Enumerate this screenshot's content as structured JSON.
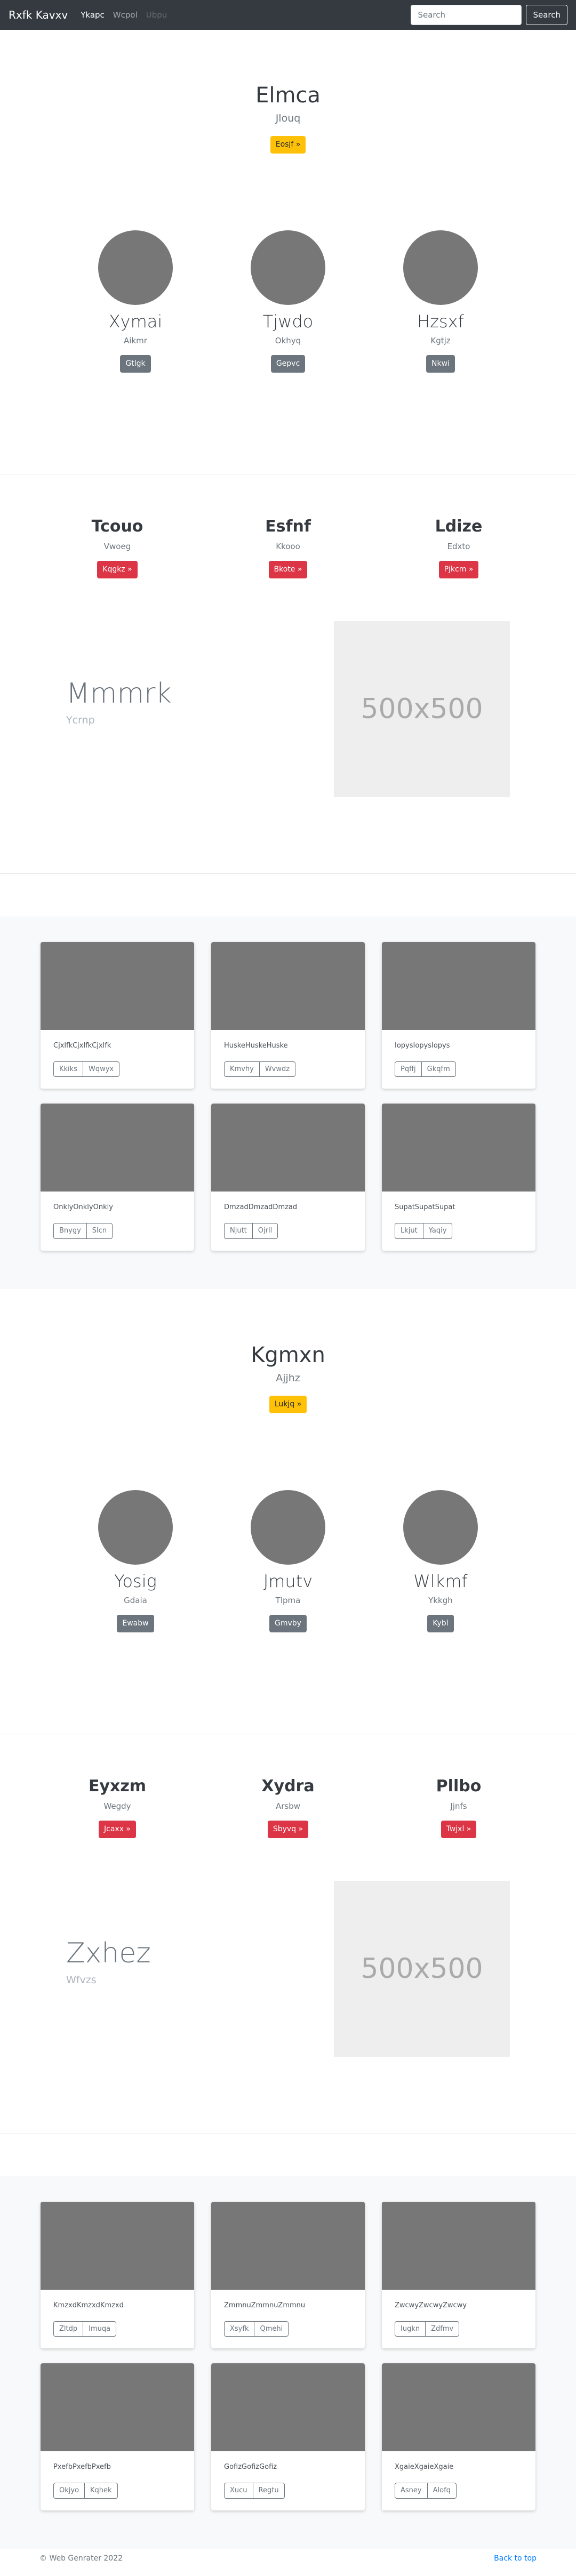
{
  "navbar": {
    "brand": "Rxfk Kavxv",
    "links": [
      "Ykapc",
      "Wcpol",
      "Ubpu"
    ],
    "search_placeholder": "Search",
    "search_button": "Search"
  },
  "sections": [
    {
      "hero": {
        "title": "Elmca",
        "subtitle": "Jlouq",
        "button": "Eosjf »"
      },
      "team": [
        {
          "name": "Xymai",
          "role": "Aikmr",
          "button": "Gtlgk"
        },
        {
          "name": "Tjwdo",
          "role": "Okhyq",
          "button": "Gepvc"
        },
        {
          "name": "Hzsxf",
          "role": "Kgtjz",
          "button": "Nkwi"
        }
      ],
      "features": [
        {
          "title": "Tcouo",
          "subtitle": "Vwoeg",
          "button": "Kqgkz »"
        },
        {
          "title": "Esfnf",
          "subtitle": "Kkooo",
          "button": "Bkote »"
        },
        {
          "title": "Ldize",
          "subtitle": "Edxto",
          "button": "Pjkcm »"
        }
      ],
      "featurette": {
        "heading": "Mmmrk",
        "subheading": "Ycrnp",
        "placeholder": "500x500"
      },
      "cards": [
        {
          "text": "CjxlfkCjxlfkCjxlfk",
          "buttons": [
            "Kkiks",
            "Wqwyx"
          ]
        },
        {
          "text": "HuskeHuskeHuske",
          "buttons": [
            "Kmvhy",
            "Wvwdz"
          ]
        },
        {
          "text": "IopysIopysIopys",
          "buttons": [
            "Pqffj",
            "Gkqfm"
          ]
        },
        {
          "text": "OnklyOnklyOnkly",
          "buttons": [
            "Bnygy",
            "Slcn"
          ]
        },
        {
          "text": "DmzadDmzadDmzad",
          "buttons": [
            "Njutt",
            "Ojrll"
          ]
        },
        {
          "text": "SupatSupatSupat",
          "buttons": [
            "Lkjut",
            "Yaqiy"
          ]
        }
      ]
    },
    {
      "hero": {
        "title": "Kgmxn",
        "subtitle": "Ajjhz",
        "button": "Lukjq »"
      },
      "team": [
        {
          "name": "Yosig",
          "role": "Gdaia",
          "button": "Ewabw"
        },
        {
          "name": "Jmutv",
          "role": "Tlpma",
          "button": "Gmvby"
        },
        {
          "name": "Wlkmf",
          "role": "Ykkgh",
          "button": "Kybl"
        }
      ],
      "features": [
        {
          "title": "Eyxzm",
          "subtitle": "Wegdy",
          "button": "Jcaxx »"
        },
        {
          "title": "Xydra",
          "subtitle": "Arsbw",
          "button": "Sbyvq »"
        },
        {
          "title": "Pllbo",
          "subtitle": "Jjnfs",
          "button": "Twjxl »"
        }
      ],
      "featurette": {
        "heading": "Zxhez",
        "subheading": "Wfvzs",
        "placeholder": "500x500"
      },
      "cards": [
        {
          "text": "KmzxdKmzxdKmzxd",
          "buttons": [
            "Zltdp",
            "Imuqa"
          ]
        },
        {
          "text": "ZmmnuZmmnuZmmnu",
          "buttons": [
            "Xsyfk",
            "Qmehi"
          ]
        },
        {
          "text": "ZwcwyZwcwyZwcwy",
          "buttons": [
            "Iugkn",
            "Zdfmv"
          ]
        },
        {
          "text": "PxefbPxefbPxefb",
          "buttons": [
            "Okjyo",
            "Kqhek"
          ]
        },
        {
          "text": "GofizGofizGofiz",
          "buttons": [
            "Xucu",
            "Regtu"
          ]
        },
        {
          "text": "XgaieXgaieXgaie",
          "buttons": [
            "Asney",
            "Alofq"
          ]
        }
      ]
    }
  ],
  "footer": {
    "copyright": "© Web Genrater 2022",
    "back_to_top": "Back to top"
  }
}
